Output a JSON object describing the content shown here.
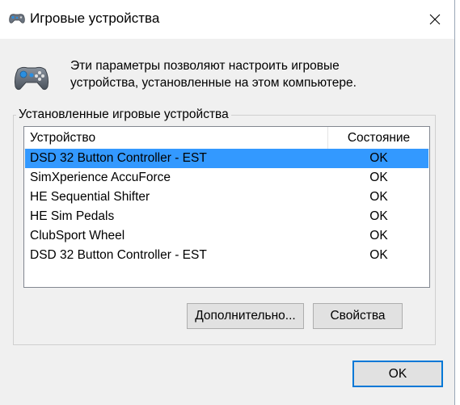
{
  "window": {
    "title": "Игровые устройства",
    "icons": {
      "title_icon": "gamepad-icon",
      "close_icon": "close-icon"
    }
  },
  "description": {
    "icon": "gamepad-icon",
    "line1": "Эти параметры позволяют настроить игровые",
    "line2": "устройства, установленные на этом компьютере."
  },
  "group": {
    "label": "Установленные игровые устройства"
  },
  "list": {
    "columns": {
      "device": "Устройство",
      "state": "Состояние"
    },
    "selected_index": 0,
    "rows": [
      {
        "device": "DSD 32 Button Controller - EST",
        "state": "OK"
      },
      {
        "device": "SimXperience AccuForce",
        "state": "OK"
      },
      {
        "device": "HE Sequential Shifter",
        "state": "OK"
      },
      {
        "device": "HE Sim Pedals",
        "state": "OK"
      },
      {
        "device": "ClubSport Wheel",
        "state": "OK"
      },
      {
        "device": "DSD 32 Button Controller - EST",
        "state": "OK"
      }
    ]
  },
  "buttons": {
    "advanced": "Дополнительно...",
    "properties": "Свойства",
    "ok": "OK"
  },
  "colors": {
    "selection": "#3399ff",
    "default_button_border": "#0078d7",
    "dialog_background": "#f0f0f0"
  }
}
